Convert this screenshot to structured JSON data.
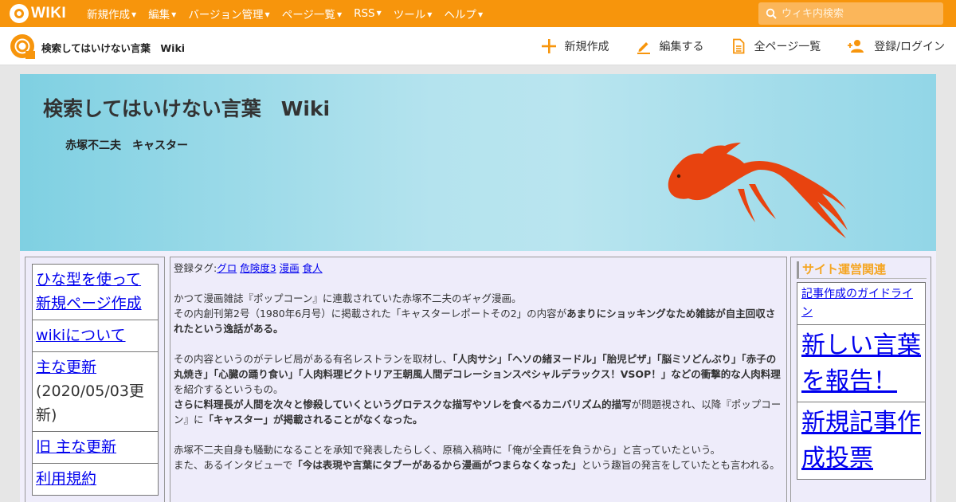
{
  "topbar": {
    "logo_text": "WIKI",
    "menu": [
      {
        "label": "新規作成"
      },
      {
        "label": "編集"
      },
      {
        "label": "バージョン管理"
      },
      {
        "label": "ページ一覧"
      },
      {
        "label": "RSS"
      },
      {
        "label": "ツール"
      },
      {
        "label": "ヘルプ"
      }
    ],
    "search_placeholder": "ウィキ内検索"
  },
  "subbar": {
    "site_name": "検索してはいけない言葉　Wiki",
    "actions": {
      "new": "新規作成",
      "edit": "編集する",
      "all_pages": "全ページ一覧",
      "login": "登録/ログイン"
    }
  },
  "banner": {
    "title": "検索してはいけない言葉　Wiki",
    "page_title": "赤塚不二夫　キャスター"
  },
  "left_menu": {
    "items": [
      {
        "label": "ひな型を使って新規ページ作成"
      },
      {
        "label": "wikiについて"
      },
      {
        "label": "主な更新",
        "note": "(2020/05/03更新)"
      },
      {
        "label": "旧 主な更新"
      },
      {
        "label": "利用規約"
      }
    ]
  },
  "main": {
    "tags_label": "登録タグ:",
    "tags": [
      "グロ",
      "危険度3",
      "漫画",
      "食人"
    ],
    "p1_line1": "かつて漫画雑誌『ポップコーン』に連載されていた赤塚不二夫のギャグ漫画。",
    "p1_line2_a": "その内創刊第2号（1980年6月号）に掲載された「キャスターレポートその2」の内容が",
    "p1_line2_b": "あまりにショッキングなため雑誌が自主回収されたという逸話がある。",
    "p2_a": "その内容というのがテレビ局がある有名レストランを取材し、",
    "p2_b": "「人肉サシ」「ヘソの緒ヌードル」「胎児ピザ」「脳ミソどんぶり」「赤子の丸焼き」「心臓の踊り食い」「人肉料理ビクトリア王朝風人間デコレーションスペシャルデラックス！VSOP！」などの衝撃的な人肉料理",
    "p2_c": "を紹介するというもの。",
    "p3_a": "さらに料理長が人間を次々と惨殺していくというグロテスクな描写やソレを食べるカニバリズム的描写",
    "p3_b": "が問題視され、以降『ポップコーン』に",
    "p3_c": "「キャスター」が掲載されることがなくなった。",
    "p4_line1": "赤塚不二夫自身も騒動になることを承知で発表したらしく、原稿入稿時に「俺が全責任を負うから」と言っていたという。",
    "p4_line2_a": "また、あるインタビューで",
    "p4_line2_b": "「今は表現や言葉にタブーがあるから漫画がつまらなくなった」",
    "p4_line2_c": "という趣旨の発言をしていたとも言われる。"
  },
  "right_menu": {
    "heading": "サイト運営関連",
    "items": [
      {
        "label": "記事作成のガイドライン"
      },
      {
        "label": "新しい言葉を報告！"
      },
      {
        "label": "新規記事作成投票"
      }
    ]
  },
  "colors": {
    "brand_orange": "#f7950c",
    "link_blue": "#0000ee",
    "fish_orange": "#e8430f",
    "heading_orange": "#f5a623"
  }
}
